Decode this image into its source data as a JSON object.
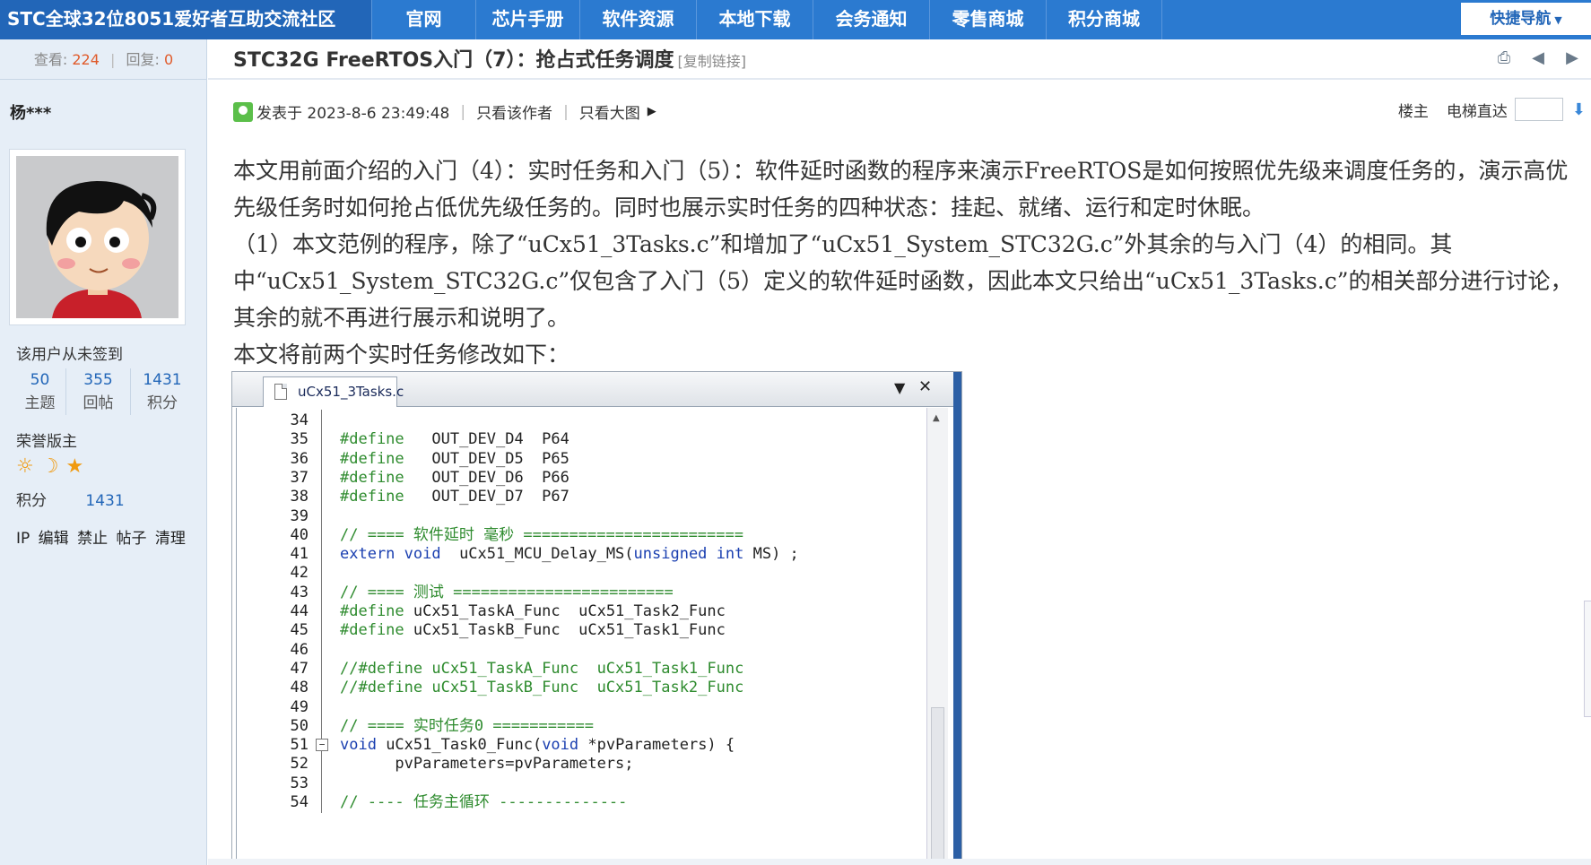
{
  "nav": {
    "brand": "STC全球32位8051爱好者互助交流社区",
    "items": [
      "官网",
      "芯片手册",
      "软件资源",
      "本地下载",
      "会务通知",
      "零售商城",
      "积分商城"
    ],
    "quick_nav": "快捷导航"
  },
  "sidebar": {
    "views_label": "查看:",
    "views": "224",
    "replies_label": "回复:",
    "replies": "0",
    "username": "杨***",
    "sign_status": "该用户从未签到",
    "stats": [
      {
        "num": "50",
        "label": "主题"
      },
      {
        "num": "355",
        "label": "回帖"
      },
      {
        "num": "1431",
        "label": "积分"
      }
    ],
    "rank": "荣誉版主",
    "points_label": "积分",
    "points": "1431",
    "actions": [
      "IP",
      "编辑",
      "禁止",
      "帖子",
      "清理"
    ]
  },
  "thread": {
    "title": "STC32G FreeRTOS入门（7）：抢占式任务调度",
    "copy_link": "[复制链接]",
    "posted": "发表于 2023-8-6 23:49:48",
    "only_author": "只看该作者",
    "only_big_image": "只看大图",
    "floor": "楼主",
    "elevator": "电梯直达"
  },
  "post": {
    "paragraphs": [
      "本文用前面介绍的入门（4）：实时任务和入门（5）：软件延时函数的程序来演示FreeRTOS是如何按照优先级来调度任务的，演示高优先级任务时如何抢占低优先级任务的。同时也展示实时任务的四种状态：挂起、就绪、运行和定时休眠。",
      "（1）本文范例的程序，除了“uCx51_3Tasks.c”和增加了“uCx51_System_STC32G.c”外其余的与入门（4）的相同。其中“uCx51_System_STC32G.c”仅包含了入门（5）定义的软件延时函数，因此本文只给出“uCx51_3Tasks.c”的相关部分进行讨论，其余的就不再进行展示和说明了。",
      "本文将前两个实时任务修改如下："
    ]
  },
  "editor": {
    "tab": "uCx51_3Tasks.c",
    "lines": [
      {
        "n": "34",
        "parts": []
      },
      {
        "n": "35",
        "parts": [
          {
            "c": "pp",
            "t": "#define"
          },
          {
            "c": "tx",
            "t": "   OUT_DEV_D4  P64"
          }
        ]
      },
      {
        "n": "36",
        "parts": [
          {
            "c": "pp",
            "t": "#define"
          },
          {
            "c": "tx",
            "t": "   OUT_DEV_D5  P65"
          }
        ]
      },
      {
        "n": "37",
        "parts": [
          {
            "c": "pp",
            "t": "#define"
          },
          {
            "c": "tx",
            "t": "   OUT_DEV_D6  P66"
          }
        ]
      },
      {
        "n": "38",
        "parts": [
          {
            "c": "pp",
            "t": "#define"
          },
          {
            "c": "tx",
            "t": "   OUT_DEV_D7  P67"
          }
        ]
      },
      {
        "n": "39",
        "parts": []
      },
      {
        "n": "40",
        "parts": [
          {
            "c": "cm",
            "t": "// ==== 软件延时 毫秒 ========================"
          }
        ]
      },
      {
        "n": "41",
        "parts": [
          {
            "c": "kw",
            "t": "extern void"
          },
          {
            "c": "tx",
            "t": "  uCx51_MCU_Delay_MS("
          },
          {
            "c": "kw",
            "t": "unsigned int"
          },
          {
            "c": "tx",
            "t": " MS) ;"
          }
        ]
      },
      {
        "n": "42",
        "parts": []
      },
      {
        "n": "43",
        "parts": [
          {
            "c": "cm",
            "t": "// ==== 测试 ========================"
          }
        ]
      },
      {
        "n": "44",
        "parts": [
          {
            "c": "pp",
            "t": "#define"
          },
          {
            "c": "tx",
            "t": " uCx51_TaskA_Func  uCx51_Task2_Func"
          }
        ]
      },
      {
        "n": "45",
        "parts": [
          {
            "c": "pp",
            "t": "#define"
          },
          {
            "c": "tx",
            "t": " uCx51_TaskB_Func  uCx51_Task1_Func"
          }
        ]
      },
      {
        "n": "46",
        "parts": []
      },
      {
        "n": "47",
        "parts": [
          {
            "c": "cm",
            "t": "//#define uCx51_TaskA_Func  uCx51_Task1_Func"
          }
        ]
      },
      {
        "n": "48",
        "parts": [
          {
            "c": "cm",
            "t": "//#define uCx51_TaskB_Func  uCx51_Task2_Func"
          }
        ]
      },
      {
        "n": "49",
        "parts": []
      },
      {
        "n": "50",
        "parts": [
          {
            "c": "cm",
            "t": "// ==== 实时任务0 ==========="
          }
        ]
      },
      {
        "n": "51",
        "fold": true,
        "parts": [
          {
            "c": "kw",
            "t": "void"
          },
          {
            "c": "tx",
            "t": " uCx51_Task0_Func("
          },
          {
            "c": "kw",
            "t": "void"
          },
          {
            "c": "tx",
            "t": " *pvParameters) {"
          }
        ]
      },
      {
        "n": "52",
        "parts": [
          {
            "c": "tx",
            "t": "      pvParameters=pvParameters;"
          }
        ]
      },
      {
        "n": "53",
        "parts": []
      },
      {
        "n": "54",
        "parts": [
          {
            "c": "cm",
            "t": "// ---- 任务主循环 --------------"
          }
        ]
      }
    ]
  },
  "colors": {
    "nav_bg": "#2b7ad0",
    "brand_bg": "#2266b8",
    "sidebar_bg": "#e6eef7",
    "accent_red": "#e05a2a",
    "link_blue": "#2266b8",
    "code_comment": "#2e8b2e",
    "code_keyword": "#1a3fb0"
  }
}
